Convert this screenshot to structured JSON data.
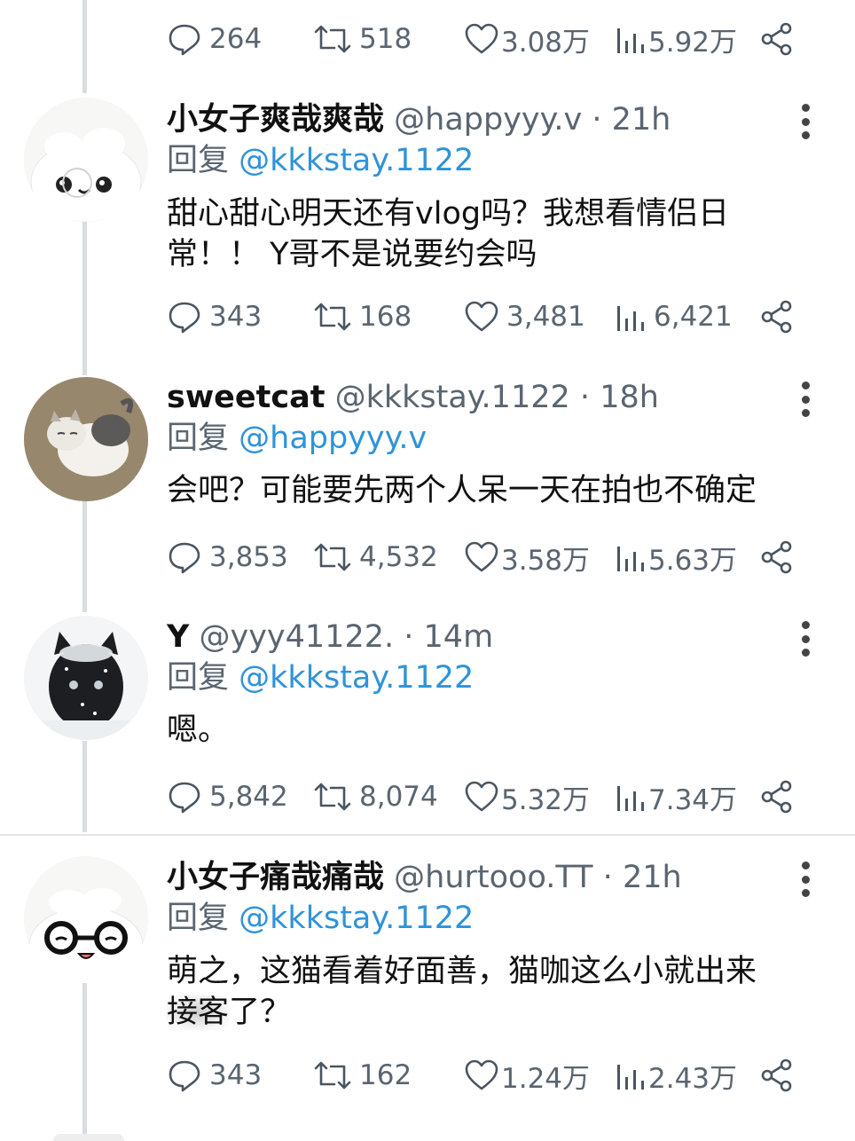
{
  "colors": {
    "mention": "#2f93d8",
    "meta": "#5a6570",
    "icon": "#4a5560"
  },
  "top_actions": {
    "replies": "264",
    "retweets": "518",
    "likes": "3.08万",
    "views": "5.92万"
  },
  "tweets": [
    {
      "name": "小女子爽哉爽哉",
      "handle": "@happyyy.v",
      "sep": "·",
      "time": "21h",
      "reply_label": "回复",
      "mention": "@kkkstay.1122",
      "text_lines": [
        "甜心甜心明天还有vlog吗？我想看情侣日",
        "常！！ Y哥不是说要约会吗"
      ],
      "replies": "343",
      "retweets": "168",
      "likes": "3,481",
      "views": "6,421",
      "avatar_icon": "cartoon-face-avatar"
    },
    {
      "name": "sweetcat",
      "handle": "@kkkstay.1122",
      "sep": "·",
      "time": "18h",
      "reply_label": "回复",
      "mention": "@happyyy.v",
      "text_lines": [
        "会吧？可能要先两个人呆一天在拍也不确定"
      ],
      "replies": "3,853",
      "retweets": "4,532",
      "likes": "3.58万",
      "views": "5.63万",
      "avatar_icon": "cat-photo-avatar"
    },
    {
      "name": "Y",
      "handle": "@yyy41122.",
      "sep": "·",
      "time": "14m",
      "reply_label": "回复",
      "mention": "@kkkstay.1122",
      "text_lines": [
        "嗯。"
      ],
      "replies": "5,842",
      "retweets": "8,074",
      "likes": "5.32万",
      "views": "7.34万",
      "avatar_icon": "black-cat-snow-avatar"
    },
    {
      "name": "小女子痛哉痛哉",
      "handle": "@hurtooo.TT",
      "sep": "·",
      "time": "21h",
      "reply_label": "回复",
      "mention": "@kkkstay.1122",
      "text_line1": "萌之，这猫看着好面善，猫咖这么小就出来",
      "text_smudged": "接客",
      "text_tail": "了？",
      "replies": "343",
      "retweets": "162",
      "likes": "1.24万",
      "views": "2.43万",
      "avatar_icon": "glasses-face-avatar"
    }
  ]
}
